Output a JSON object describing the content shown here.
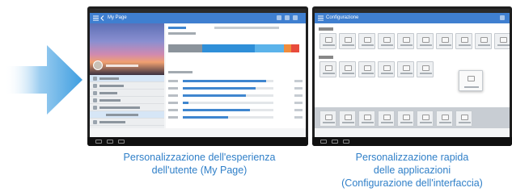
{
  "left_screenshot": {
    "app_title": "My Page",
    "caption_line1": "Personalizzazione dell'esperienza",
    "caption_line2": "dell'utente (My Page)"
  },
  "right_screenshot": {
    "app_title": "Configurazione",
    "caption_line1": "Personalizzazione rapida",
    "caption_line2": "delle applicazioni",
    "caption_line3": "(Configurazione dell'interfaccia)"
  },
  "colors": {
    "caption": "#2f7fc8",
    "arrow": "#5aaee6",
    "appbar": "#3f7fd0"
  }
}
